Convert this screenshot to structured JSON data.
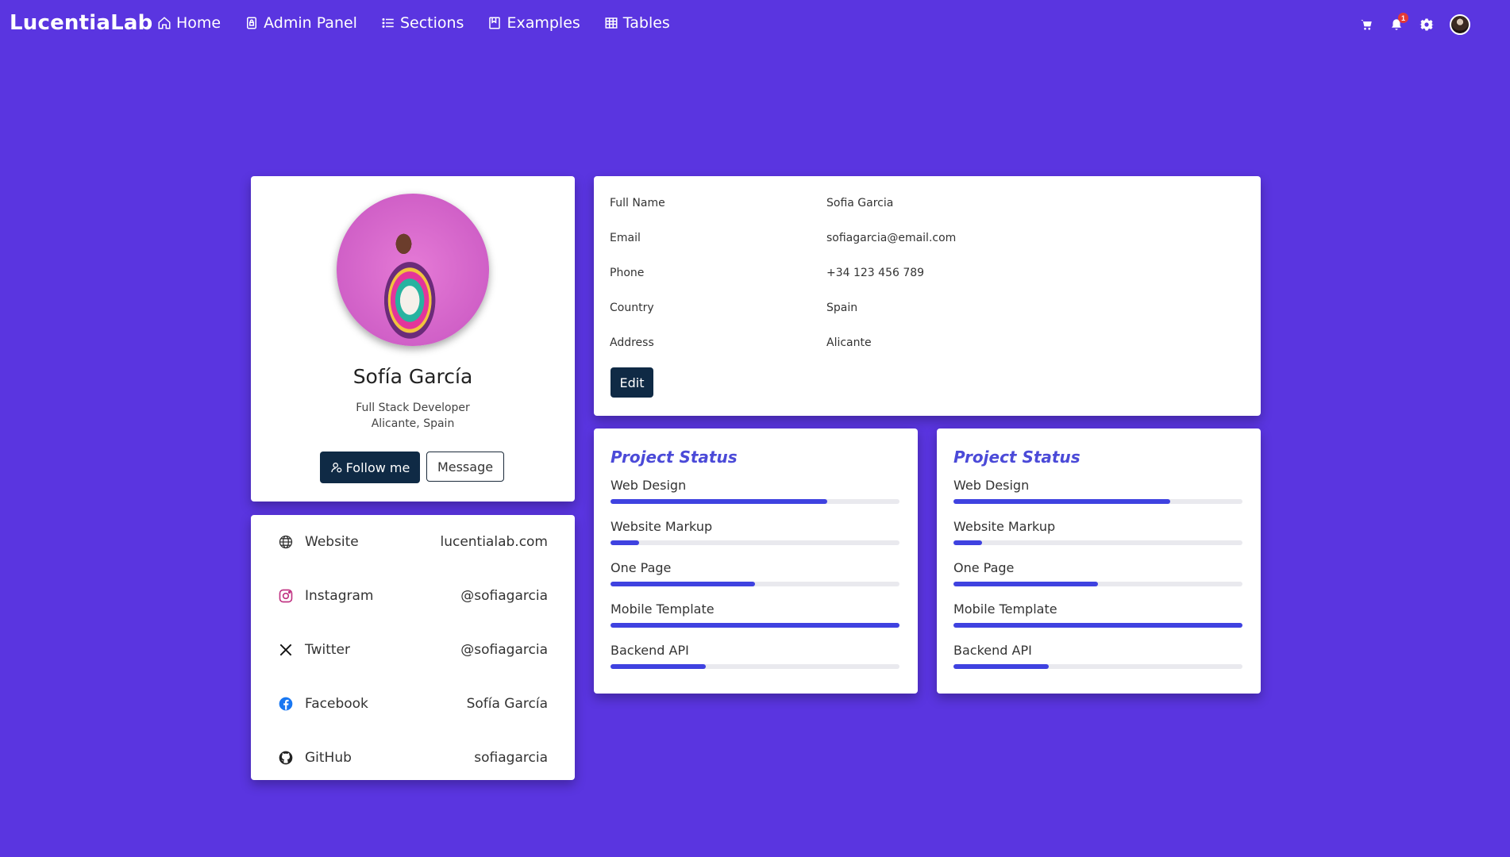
{
  "navbar": {
    "brand": "LucentiaLab",
    "links": [
      {
        "label": "Home",
        "icon": "home-icon"
      },
      {
        "label": "Admin Panel",
        "icon": "lock-icon"
      },
      {
        "label": "Sections",
        "icon": "list-icon"
      },
      {
        "label": "Examples",
        "icon": "book-icon"
      },
      {
        "label": "Tables",
        "icon": "table-icon"
      }
    ],
    "right_icons": [
      "cart-icon",
      "bell-icon",
      "gear-icon",
      "avatar"
    ],
    "notification_count": "1"
  },
  "profile": {
    "name": "Sofía García",
    "role": "Full Stack Developer",
    "location": "Alicante, Spain",
    "follow_label": "Follow me",
    "message_label": "Message"
  },
  "social": [
    {
      "icon": "globe-icon",
      "label": "Website",
      "value": "lucentialab.com"
    },
    {
      "icon": "instagram-icon",
      "label": "Instagram",
      "value": "@sofiagarcia"
    },
    {
      "icon": "x-twitter-icon",
      "label": "Twitter",
      "value": "@sofiagarcia"
    },
    {
      "icon": "facebook-icon",
      "label": "Facebook",
      "value": "Sofía García"
    },
    {
      "icon": "github-icon",
      "label": "GitHub",
      "value": "sofiagarcia"
    }
  ],
  "info": {
    "rows": [
      {
        "label": "Full Name",
        "value": "Sofia Garcia"
      },
      {
        "label": "Email",
        "value": "sofiagarcia@email.com"
      },
      {
        "label": "Phone",
        "value": "+34 123 456 789"
      },
      {
        "label": "Country",
        "value": "Spain"
      },
      {
        "label": "Address",
        "value": "Alicante"
      }
    ],
    "edit_label": "Edit"
  },
  "projects": [
    {
      "title": "Project Status",
      "items": [
        {
          "label": "Web Design",
          "progress": 75
        },
        {
          "label": "Website Markup",
          "progress": 10
        },
        {
          "label": "One Page",
          "progress": 50
        },
        {
          "label": "Mobile Template",
          "progress": 100
        },
        {
          "label": "Backend API",
          "progress": 33
        }
      ]
    },
    {
      "title": "Project Status",
      "items": [
        {
          "label": "Web Design",
          "progress": 75
        },
        {
          "label": "Website Markup",
          "progress": 10
        },
        {
          "label": "One Page",
          "progress": 50
        },
        {
          "label": "Mobile Template",
          "progress": 100
        },
        {
          "label": "Backend API",
          "progress": 33
        }
      ]
    }
  ],
  "colors": {
    "background": "#5a35e0",
    "primary_button": "#0f2a45",
    "accent": "#3f42e0",
    "title_accent": "#4b4ad8",
    "badge": "#e53935"
  }
}
